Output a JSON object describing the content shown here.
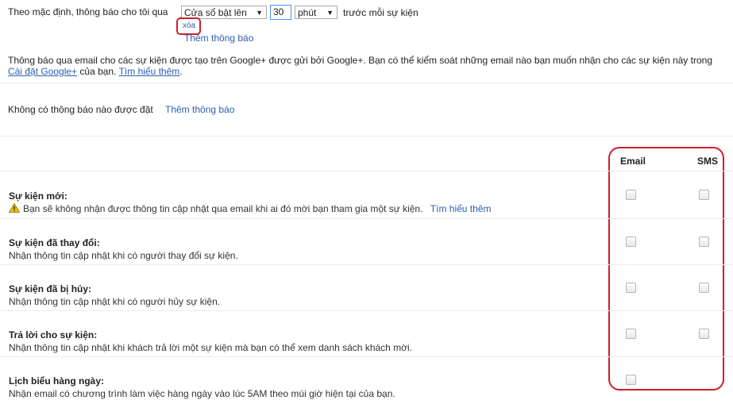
{
  "default_reminder": {
    "prefix": "Theo mặc định, thông báo cho tôi qua",
    "method": "Cửa sổ bật lên",
    "amount": "30",
    "unit": "phút",
    "suffix": "trước mỗi sự kiện",
    "remove_label": "xóa",
    "add_label": "Thêm thông báo"
  },
  "info": {
    "text": "Thông báo qua email cho các sự kiện được tạo trên Google+ được gửi bởi Google+. Bạn có thể kiểm soát những email nào bạn muốn nhận cho các sự kiện này trong",
    "settings_link": "Cài đặt Google+",
    "after_link": "của bạn.",
    "learn_more": "Tìm hiểu thêm"
  },
  "all_day": {
    "text": "Không có thông báo nào được đặt",
    "add_label": "Thêm thông báo"
  },
  "columns": {
    "email": "Email",
    "sms": "SMS"
  },
  "notifications": [
    {
      "title": "Sự kiện mới:",
      "desc": "Bạn sẽ không nhận được thông tin cập nhật qua email khi ai đó mời bạn tham gia một sự kiện.",
      "learn_more": "Tìm hiểu thêm",
      "warning": true,
      "email": false,
      "sms": false
    },
    {
      "title": "Sự kiện đã thay đổi:",
      "desc": "Nhận thông tin cập nhật khi có người thay đổi sự kiện.",
      "email": false,
      "sms": false
    },
    {
      "title": "Sự kiện đã bị hủy:",
      "desc": "Nhận thông tin cập nhật khi có người hủy sự kiện.",
      "email": false,
      "sms": false
    },
    {
      "title": "Trả lời cho sự kiện:",
      "desc": "Nhận thông tin cập nhật khi khách trả lời một sự kiện mà bạn có thể xem danh sách khách mời.",
      "email": false,
      "sms": false
    },
    {
      "title": "Lịch biểu hàng ngày:",
      "desc": "Nhận email có chương trình làm việc hàng ngày vào lúc 5AM theo múi giờ hiện tại của bạn.",
      "email": false
    }
  ],
  "colors": {
    "link": "#2a5db0",
    "highlight": "#d11e2a"
  }
}
